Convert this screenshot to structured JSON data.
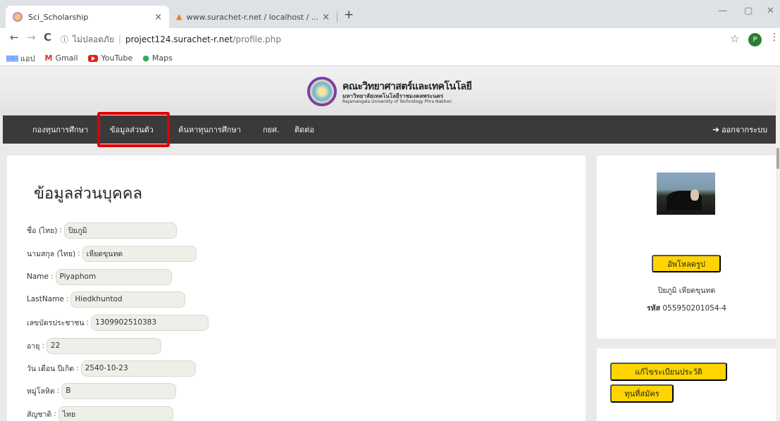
{
  "browser": {
    "tabs": [
      {
        "label": "Sci_Scholarship",
        "close": "×"
      },
      {
        "label": "www.surachet-r.net / localhost / ...",
        "close": "×"
      }
    ],
    "new_tab": "+",
    "window_controls": {
      "minimize": "—",
      "restore": "▢",
      "close": "✕"
    },
    "nav": {
      "back": "←",
      "forward": "→",
      "reload": "C"
    },
    "address": {
      "security_label": "ไม่ปลอดภัย",
      "separator": "|",
      "host": "project124.surachet-r.net",
      "path": "/profile.php"
    },
    "profile_initial": "P",
    "bookmarks": [
      {
        "label": "แอป",
        "icon": "apps-grid-icon"
      },
      {
        "label": "Gmail",
        "icon": "gmail-icon"
      },
      {
        "label": "YouTube",
        "icon": "youtube-icon"
      },
      {
        "label": "Maps",
        "icon": "maps-pin-icon"
      }
    ]
  },
  "site": {
    "logo": {
      "title_th": "คณะวิทยาศาสตร์และเทคโนโลยี",
      "subtitle_th": "มหาวิทยาลัยเทคโนโลยีราชมงคลพระนคร",
      "subtitle_en": "Rajamangala University of Technology Phra Nakhon"
    },
    "menu": {
      "items": [
        "กองทุนการศึกษา",
        "ข้อมูลส่วนตัว",
        "ค้นหาทุนการศึกษา",
        "กยศ.",
        "ติดต่อ"
      ],
      "active_index": 1,
      "logout": "ออกจากระบบ"
    },
    "accent_color": "#ffd400",
    "highlight_color": "#e00000"
  },
  "profile": {
    "title": "ข้อมูลส่วนบุคคล",
    "fields": [
      {
        "label": "ชื่อ (ไทย)",
        "value": "ปิยภูมิ"
      },
      {
        "label": "นามสกุล (ไทย)",
        "value": "เหียดขุนทด"
      },
      {
        "label": "Name",
        "value": "Piyaphom"
      },
      {
        "label": "LastName",
        "value": "Hiedkhuntod"
      },
      {
        "label": "เลขบัตรประชาชน",
        "value": "1309902510383"
      },
      {
        "label": "อายุ",
        "value": "22"
      },
      {
        "label": "วัน เดือน ปีเกิด",
        "value": "2540-10-23"
      },
      {
        "label": "หมู่โลหิต",
        "value": "B"
      },
      {
        "label": "สัญชาติ",
        "value": "ไทย"
      }
    ]
  },
  "sidebar": {
    "upload_button": "อัพโหลดรูป",
    "name": "ปิยภูมิ เหียดขุนทด",
    "id_label": "รหัส",
    "id_value": "055950201054-4",
    "buttons": [
      "แก้ไขระเบียนประวัติ",
      "ทุนที่สมัคร"
    ]
  }
}
